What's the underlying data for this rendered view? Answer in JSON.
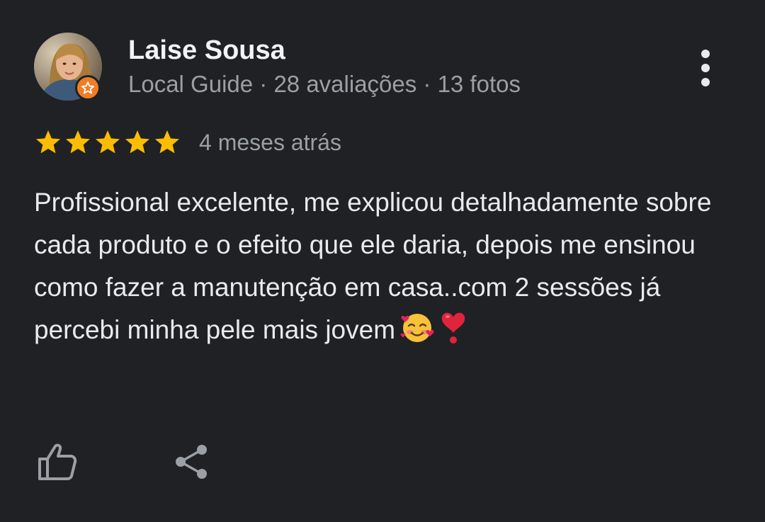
{
  "review": {
    "author": {
      "name": "Laise Sousa",
      "meta": "Local Guide · 28 avaliações · 13 fotos",
      "avatar_icon": "user-avatar-photo",
      "badge_icon": "local-guide-star-badge",
      "badge_color": "#ef7d28"
    },
    "rating": {
      "stars": 5,
      "max": 5,
      "star_color": "#fbbc04",
      "date": "4 meses atrás"
    },
    "text": "Profissional excelente, me explicou detalhadamente sobre cada produto e o efeito que ele daria, depois me ensinou como fazer a manutenção em casa..com 2 sessões já percebi minha pele mais jovem",
    "emojis": [
      "smiling-face-with-hearts",
      "heavy-heart-exclamation"
    ],
    "actions": {
      "more_icon": "more-vert-icon",
      "like_icon": "thumbs-up-icon",
      "share_icon": "share-icon"
    }
  },
  "colors": {
    "background": "#202124",
    "primary_text": "#e8eaed",
    "secondary_text": "#9aa0a6"
  }
}
